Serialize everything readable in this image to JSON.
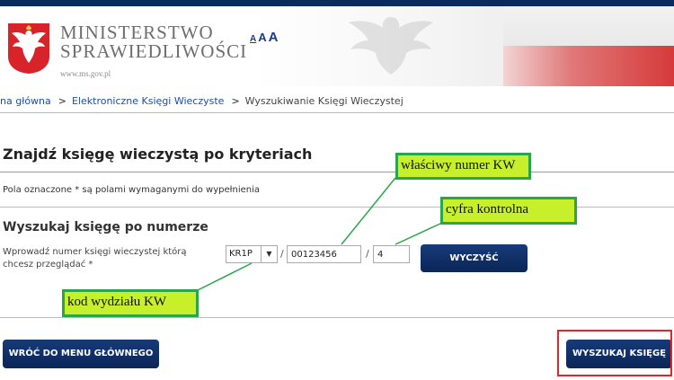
{
  "header": {
    "ministry_line1": "MINISTERSTWO",
    "ministry_line2": "SPRAWIEDLIWOŚCI",
    "url": "www.ms.gov.pl",
    "font_sizes": [
      "A",
      "A",
      "A"
    ]
  },
  "breadcrumb": {
    "items": [
      "na główna",
      "Elektroniczne Księgi Wieczyste",
      "Wyszukiwanie Księgi Wieczystej"
    ],
    "separator": ">"
  },
  "main": {
    "title": "Znajdź księgę wieczystą po kryteriach",
    "required_note": "Pola oznaczone * są polami wymaganymi do wypełnienia",
    "section_title": "Wyszukaj księgę po numerze",
    "field_label": "Wprowadź numer księgi wieczystej którą chcesz przeglądać *",
    "court_code": {
      "value": "KR1P",
      "arrow": "▼"
    },
    "separator": "/",
    "number": {
      "value": "00123456"
    },
    "check_digit": {
      "value": "4"
    },
    "clear_button": "WYCZYŚĆ",
    "back_button": "WRÓĆ DO MENU GŁÓWNEGO",
    "search_button": "WYSZUKAJ KSIĘGĘ"
  },
  "annotations": {
    "number_label": "właściwy numer KW",
    "check_label": "cyfra kontrolna",
    "court_label": "kod wydziału KW"
  },
  "colors": {
    "navy_button": "#0b2657",
    "link": "#1a4fa0",
    "callout_fill": "#c7f02b",
    "callout_border": "#2aa64a",
    "highlight_frame": "#e0262a"
  }
}
